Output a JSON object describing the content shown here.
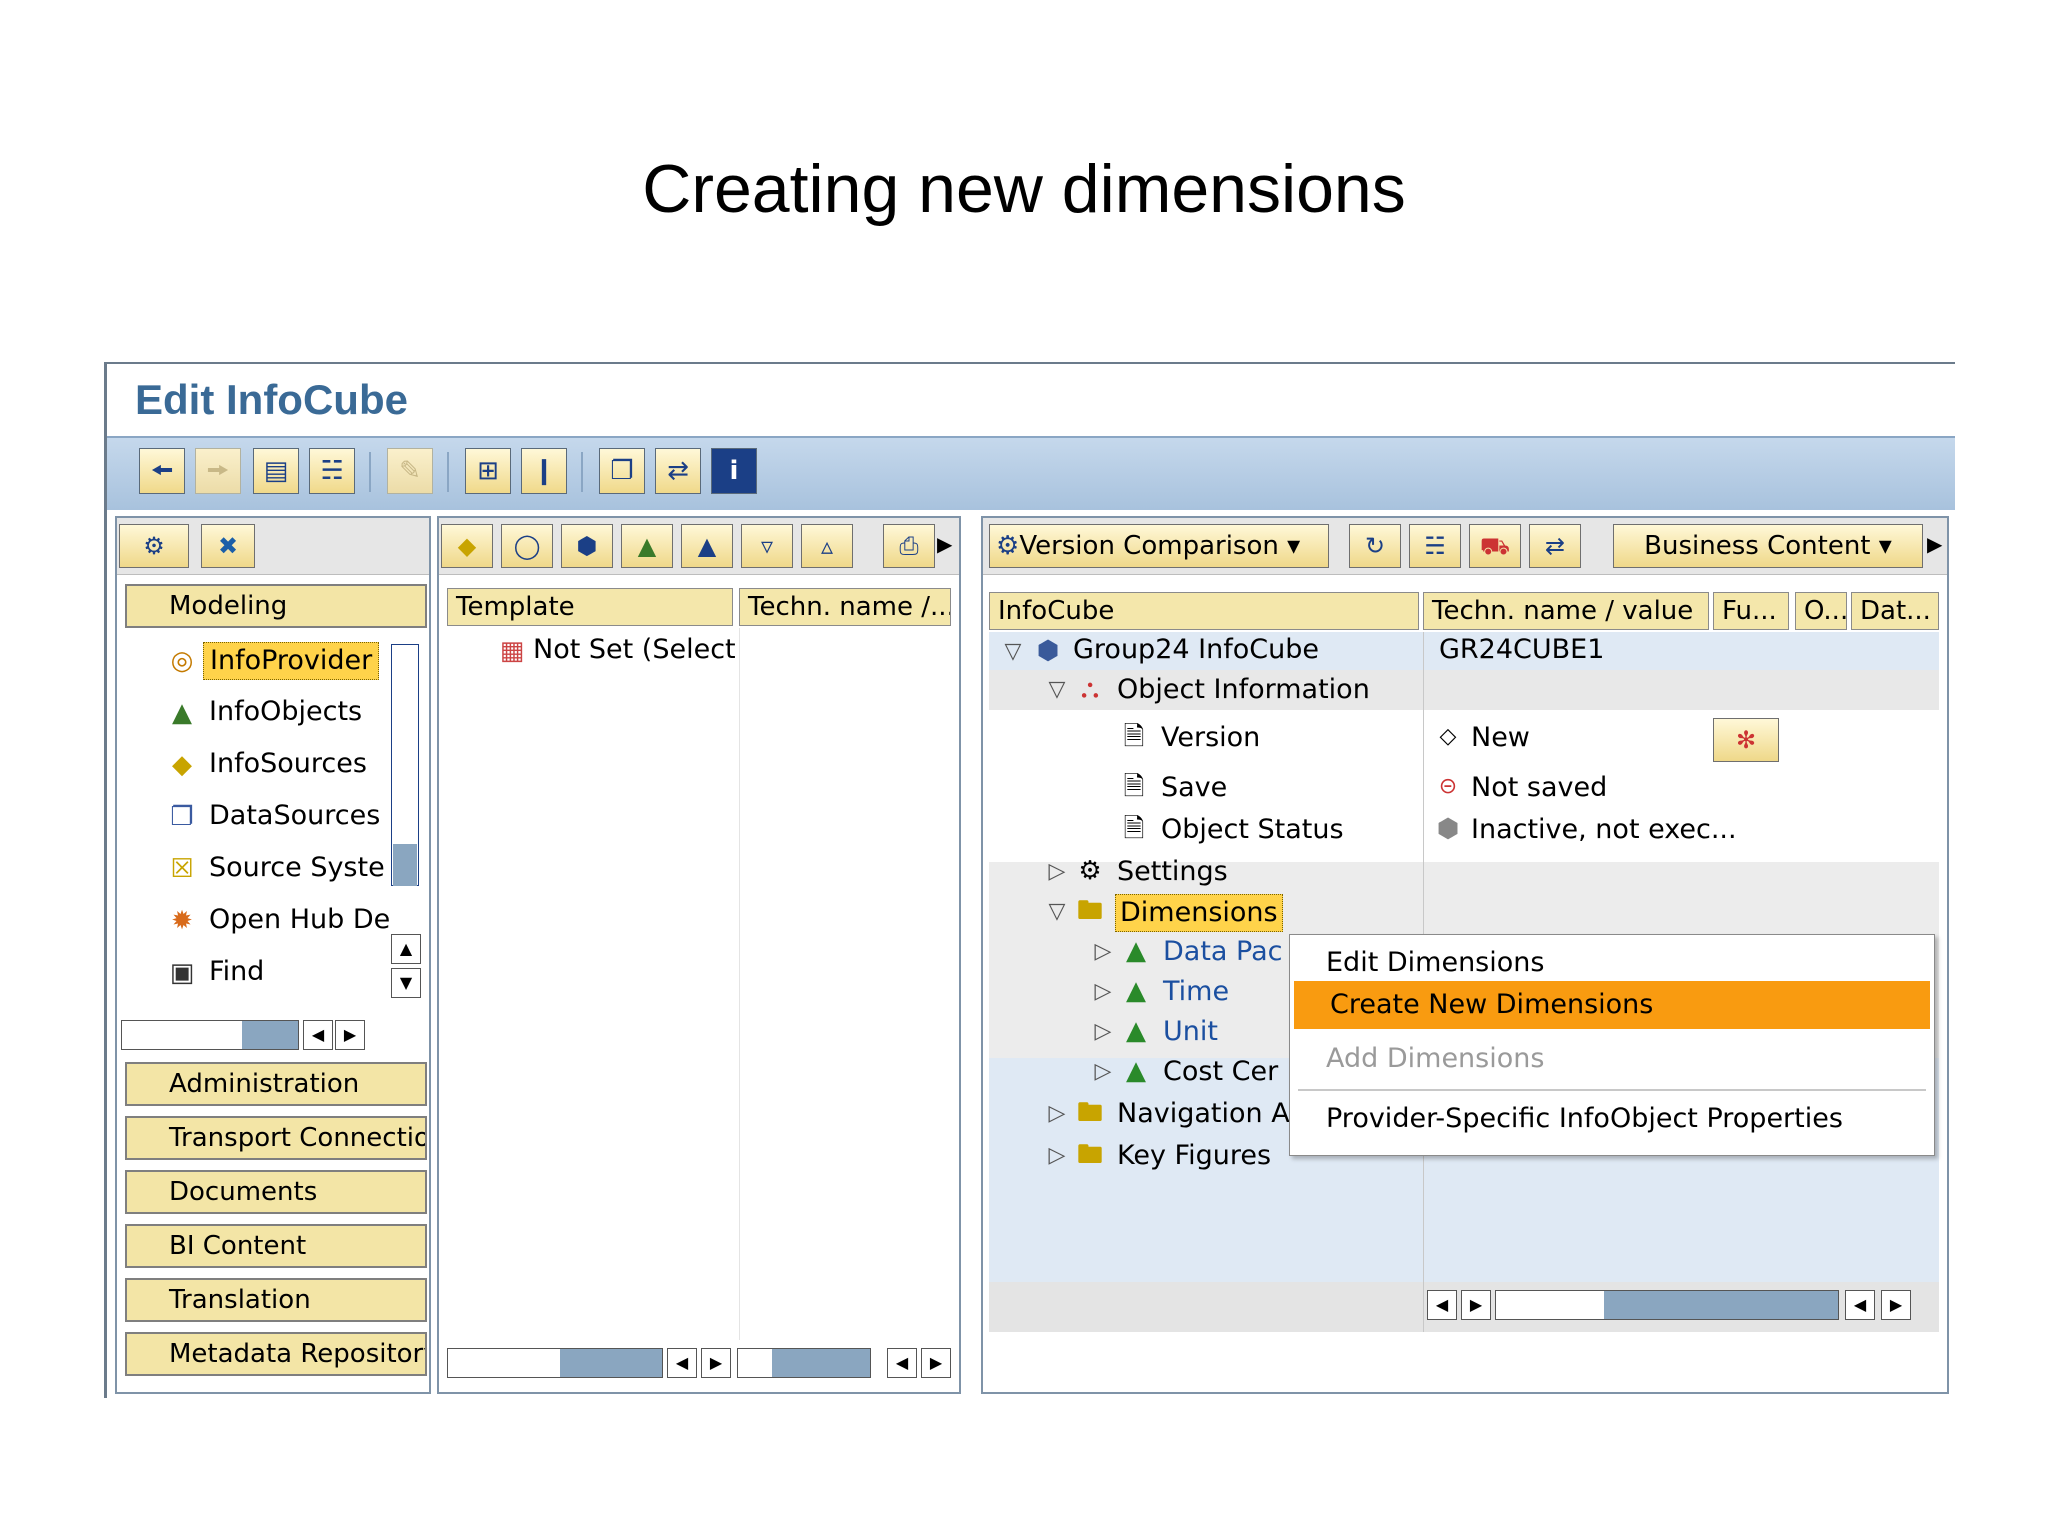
{
  "slide": {
    "title": "Creating new dimensions"
  },
  "window": {
    "title": "Edit InfoCube"
  },
  "left_panel": {
    "section_label": "Modeling",
    "tree": [
      "InfoProvider",
      "InfoObjects",
      "InfoSources",
      "DataSources",
      "Source Syste",
      "Open Hub De",
      "Find"
    ],
    "nav_buttons": [
      "Administration",
      "Transport Connectio",
      "Documents",
      "BI Content",
      "Translation",
      "Metadata Repository"
    ]
  },
  "middle_panel": {
    "headers": [
      "Template",
      "Techn. name /..."
    ],
    "rows": [
      "Not Set (Select u"
    ]
  },
  "right_panel": {
    "toolbar": {
      "version_comparison": "Version Comparison",
      "business_content": "Business Content"
    },
    "headers": [
      "InfoCube",
      "Techn. name / value",
      "Fu...",
      "O...",
      "Dat..."
    ],
    "tree": [
      {
        "label": "Group24 InfoCube",
        "value": "GR24CUBE1"
      },
      {
        "label": "Object Information",
        "value": ""
      },
      {
        "label": "Version",
        "value": "New"
      },
      {
        "label": "Save",
        "value": "Not saved"
      },
      {
        "label": "Object Status",
        "value": "Inactive, not exec..."
      },
      {
        "label": "Settings",
        "value": ""
      },
      {
        "label": "Dimensions",
        "value": ""
      },
      {
        "label": "Data Pac",
        "value": ""
      },
      {
        "label": "Time",
        "value": ""
      },
      {
        "label": "Unit",
        "value": ""
      },
      {
        "label": "Cost Cer",
        "value": ""
      },
      {
        "label": "Navigation A",
        "value": ""
      },
      {
        "label": "Key Figures",
        "value": ""
      }
    ]
  },
  "context_menu": {
    "items": [
      "Edit Dimensions",
      "Create New Dimensions",
      "Add Dimensions",
      "Provider-Specific InfoObject Properties"
    ],
    "highlighted": "Create New Dimensions"
  },
  "colors": {
    "accent": "#f99b10",
    "title_blue": "#3a6a96",
    "toolbar_blue": "#a8c2dd",
    "header_yellow": "#f4e7ab",
    "tree_highlight": "#ffd34a"
  }
}
